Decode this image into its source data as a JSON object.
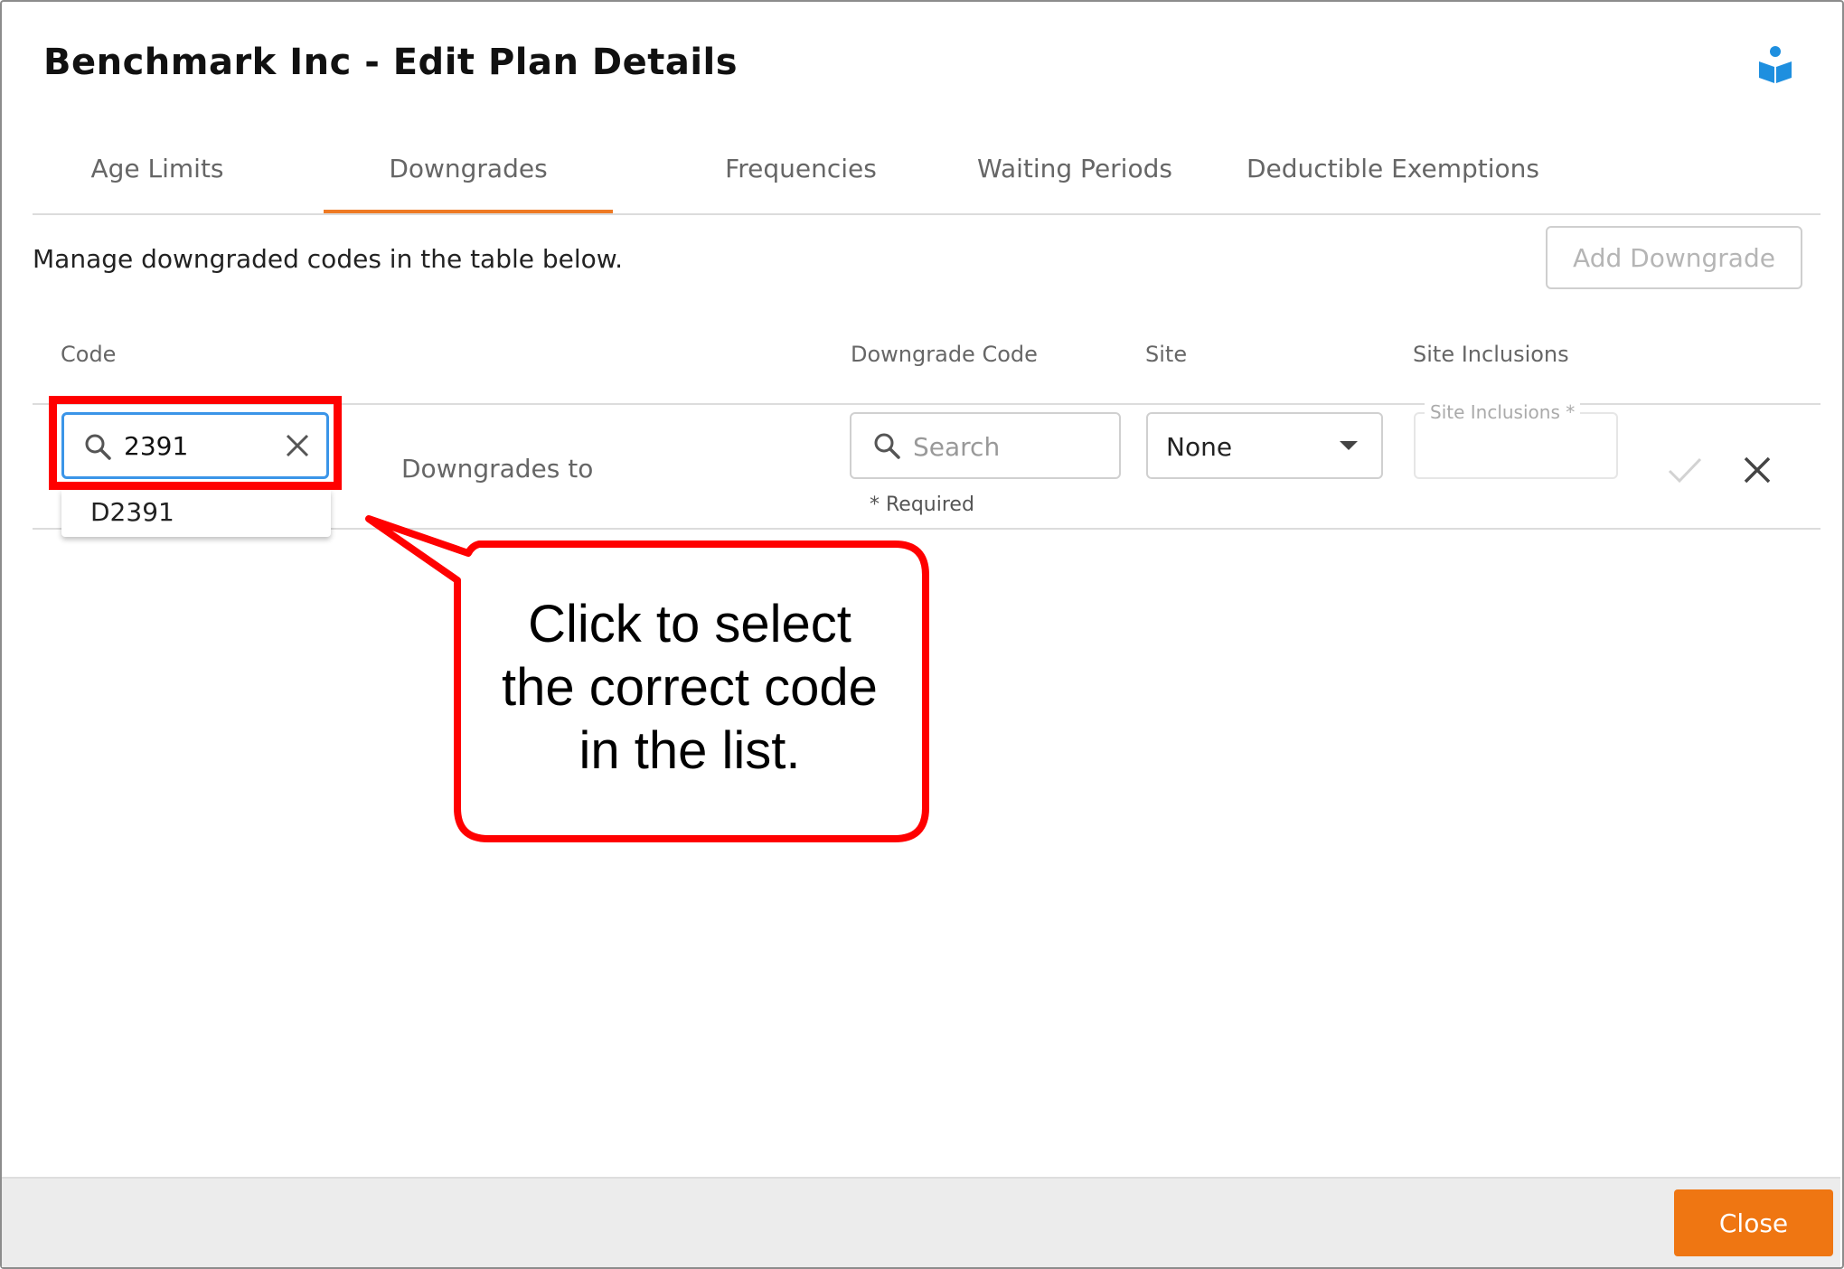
{
  "dialog": {
    "title": "Benchmark Inc - Edit Plan Details",
    "help_icon": "book-reader-icon"
  },
  "tabs": [
    {
      "label": "Age Limits",
      "active": false
    },
    {
      "label": "Downgrades",
      "active": true
    },
    {
      "label": "Frequencies",
      "active": false
    },
    {
      "label": "Waiting Periods",
      "active": false
    },
    {
      "label": "Deductible Exemptions",
      "active": false
    }
  ],
  "panel": {
    "intro": "Manage downgraded codes in the table below.",
    "add_button": "Add Downgrade"
  },
  "table": {
    "headers": {
      "code": "Code",
      "downgrade_code": "Downgrade Code",
      "site": "Site",
      "site_inclusions": "Site Inclusions"
    },
    "row": {
      "code_value": "2391",
      "code_suggestion": "D2391",
      "downgrades_to": "Downgrades to",
      "search_placeholder": "Search",
      "required_note": "* Required",
      "site_value": "None",
      "site_inclusions_label": "Site Inclusions *"
    }
  },
  "callout": {
    "text_lines": [
      "Click to select",
      "the correct code",
      "in the list."
    ],
    "border_color": "#ff0000"
  },
  "footer": {
    "close_button": "Close"
  },
  "colors": {
    "accent": "#ef7612",
    "focus": "#3b95e8",
    "highlight": "#ff0000"
  }
}
